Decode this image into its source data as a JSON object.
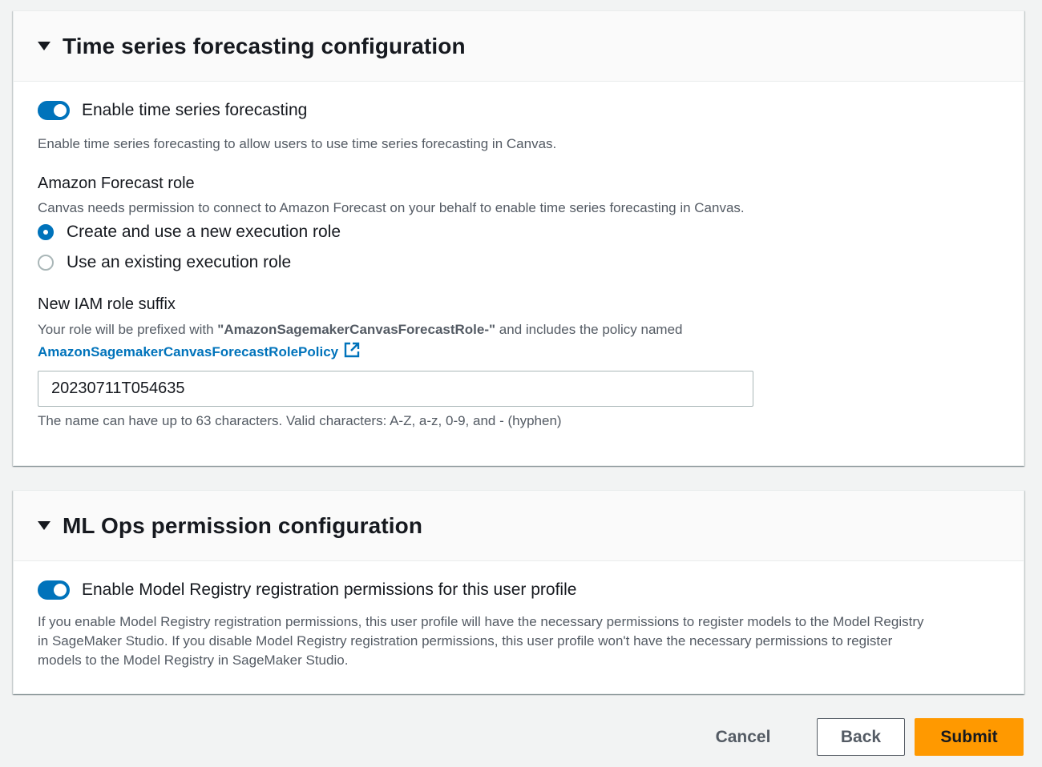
{
  "forecast_section": {
    "title": "Time series forecasting configuration",
    "toggle_label": "Enable time series forecasting",
    "toggle_on": true,
    "toggle_description": "Enable time series forecasting to allow users to use time series forecasting in Canvas.",
    "role_label": "Amazon Forecast role",
    "role_description": "Canvas needs permission to connect to Amazon Forecast on your behalf to enable time series forecasting in Canvas.",
    "radio_options": [
      {
        "label": "Create and use a new execution role",
        "selected": true
      },
      {
        "label": "Use an existing execution role",
        "selected": false
      }
    ],
    "suffix_label": "New IAM role suffix",
    "suffix_desc_prefix": "Your role will be prefixed with ",
    "suffix_desc_role": "\"AmazonSagemakerCanvasForecastRole-\"",
    "suffix_desc_middle": " and includes the policy named",
    "policy_link": "AmazonSagemakerCanvasForecastRolePolicy",
    "suffix_value": "20230711T054635",
    "suffix_constraint": "The name can have up to 63 characters. Valid characters: A-Z, a-z, 0-9, and - (hyphen)"
  },
  "mlops_section": {
    "title": "ML Ops permission configuration",
    "toggle_label": "Enable Model Registry registration permissions for this user profile",
    "toggle_on": true,
    "description_lines": [
      "If you enable Model Registry registration permissions, this user profile will have the necessary permissions to register models to the Model Registry",
      "in SageMaker Studio. If you disable Model Registry registration permissions, this user profile won't have the necessary permissions to register",
      "models to the Model Registry in SageMaker Studio."
    ]
  },
  "footer": {
    "cancel_label": "Cancel",
    "back_label": "Back",
    "submit_label": "Submit"
  },
  "colors": {
    "accent": "#0073bb",
    "primary_button": "#ff9900"
  },
  "icons": {
    "caret": "caret-down-icon",
    "external_link": "external-link-icon"
  }
}
